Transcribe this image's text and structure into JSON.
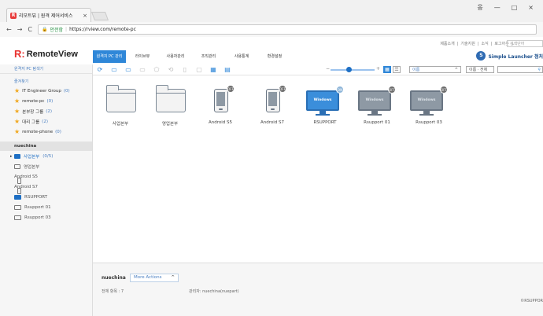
{
  "browser": {
    "tab_title": "리모트뷰 | 원격 제어서비스",
    "tab_close": "×",
    "window_controls": [
      "옹",
      "—",
      "□",
      "×"
    ],
    "nav_back": "←",
    "nav_forward": "→",
    "nav_reload": "C",
    "security_label": "안전함",
    "url": "https://rview.com/remote-pc"
  },
  "header": {
    "top_links": [
      "제품소개",
      "|",
      "기술지원",
      "|",
      "소식",
      "|",
      "로그아웃",
      "⌄"
    ],
    "top_search_placeholder": "검색단어",
    "logo_r": "R:",
    "logo_text": "RemoteView",
    "nav_tabs": [
      {
        "label": "원격지 PC 관리",
        "active": true
      },
      {
        "label": "라이브뷰"
      },
      {
        "label": "사용자관리"
      },
      {
        "label": "조직관리"
      },
      {
        "label": "사용통계"
      },
      {
        "label": "환경설정"
      }
    ],
    "avatar_initial": "S",
    "launcher_label": "Simple Launcher 첨처"
  },
  "sidebar": {
    "search_label": "원격지 PC 탐색기",
    "favorites_title": "즐겨찾기",
    "favorites": [
      {
        "label": "IT Engineer Group",
        "count": "(0)"
      },
      {
        "label": "remote-pc",
        "count": "(0)"
      },
      {
        "label": "본부장 그룹",
        "count": "(2)"
      },
      {
        "label": "대리 그룹",
        "count": "(2)"
      },
      {
        "label": "remote-phone",
        "count": "(0)"
      }
    ],
    "user": "nuechina",
    "items": [
      {
        "label": "사업본부",
        "count": "(0/5)",
        "icon": "folder-filled-icon"
      },
      {
        "label": "영업본부",
        "count": "",
        "icon": "folder-icon"
      },
      {
        "label": "Android S5",
        "count": "",
        "icon": "phone-icon"
      },
      {
        "label": "Android S7",
        "count": "",
        "icon": "phone-icon"
      },
      {
        "label": "RSUPPORT",
        "count": "",
        "icon": "monitor-active-icon"
      },
      {
        "label": "Rsupport 01",
        "count": "",
        "icon": "monitor-icon"
      },
      {
        "label": "Rsupport 03",
        "count": "",
        "icon": "monitor-icon"
      }
    ]
  },
  "toolbar": {
    "sort_label": "이름",
    "sort_chevron": "^",
    "filter_label": "이름 · 전체",
    "search_icon": "search-icon",
    "minus": "−",
    "plus": "+"
  },
  "grid": [
    {
      "label": "사업본부",
      "type": "folder"
    },
    {
      "label": "영업본부",
      "type": "folder"
    },
    {
      "label": "Android S5",
      "type": "phone",
      "badge": "OFF"
    },
    {
      "label": "Android S7",
      "type": "phone",
      "badge": "OFF"
    },
    {
      "label": "RSUPPORT",
      "type": "pc-active",
      "badge": "ON",
      "screen": "Windows"
    },
    {
      "label": "Rsupport 01",
      "type": "pc",
      "badge": "OFF",
      "screen": "Windows"
    },
    {
      "label": "Rsupport 03",
      "type": "pc",
      "badge": "OFF",
      "screen": "Windows"
    }
  ],
  "bottom": {
    "name": "nuechina",
    "more_actions": "More Actions",
    "more_chevron": "^",
    "total": "전체 항목 : 7",
    "manager": "관리자: nuechina(nuepart)",
    "copyright": "©RSUPPOR"
  },
  "colors": {
    "accent": "#2f87d8",
    "brand_red": "#e8322f",
    "active_pc": "#3b8edb"
  }
}
